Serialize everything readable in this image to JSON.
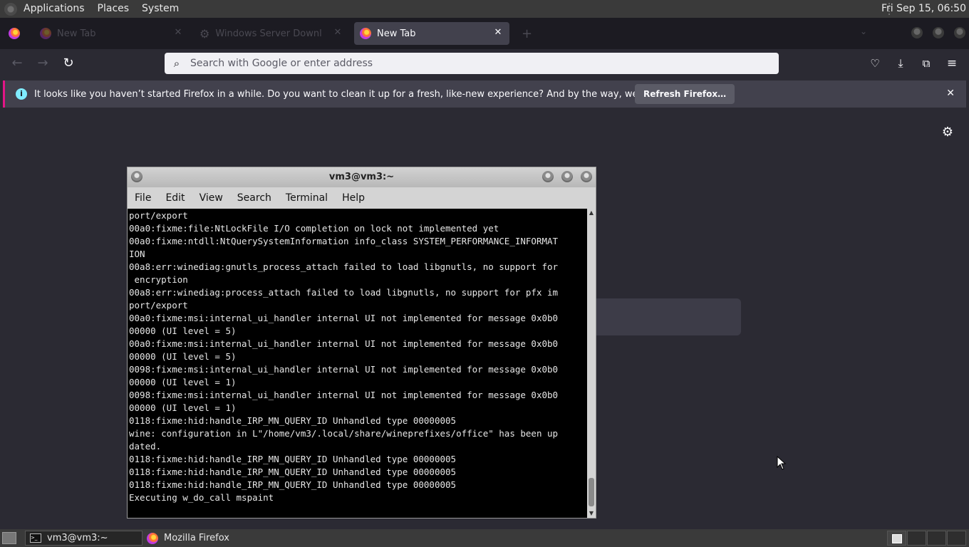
{
  "top_panel": {
    "menus": [
      "Applications",
      "Places",
      "System"
    ],
    "clock": "Fri Sep 15, 06:50"
  },
  "browser": {
    "tabs": [
      {
        "label": "New Tab",
        "active": false
      },
      {
        "label": "Windows Server Downlo",
        "active": false
      },
      {
        "label": "New Tab",
        "active": true
      }
    ],
    "new_tab_symbol": "+",
    "close_symbol": "✕",
    "url_placeholder": "Search with Google or enter address"
  },
  "notification": {
    "message": "It looks like you haven’t started Firefox in a while. Do you want to clean it up for a fresh, like-new experience? And by the way, welcome back!",
    "button": "Refresh Firefox…"
  },
  "terminal": {
    "title": "vm3@vm3:~",
    "menu": [
      "File",
      "Edit",
      "View",
      "Search",
      "Terminal",
      "Help"
    ],
    "lines": [
      "port/export",
      "00a0:fixme:file:NtLockFile I/O completion on lock not implemented yet",
      "00a0:fixme:ntdll:NtQuerySystemInformation info_class SYSTEM_PERFORMANCE_INFORMAT",
      "ION",
      "00a8:err:winediag:gnutls_process_attach failed to load libgnutls, no support for",
      " encryption",
      "00a8:err:winediag:process_attach failed to load libgnutls, no support for pfx im",
      "port/export",
      "00a0:fixme:msi:internal_ui_handler internal UI not implemented for message 0x0b0",
      "00000 (UI level = 5)",
      "00a0:fixme:msi:internal_ui_handler internal UI not implemented for message 0x0b0",
      "00000 (UI level = 5)",
      "0098:fixme:msi:internal_ui_handler internal UI not implemented for message 0x0b0",
      "00000 (UI level = 1)",
      "0098:fixme:msi:internal_ui_handler internal UI not implemented for message 0x0b0",
      "00000 (UI level = 1)",
      "0118:fixme:hid:handle_IRP_MN_QUERY_ID Unhandled type 00000005",
      "wine: configuration in L\"/home/vm3/.local/share/wineprefixes/office\" has been up",
      "dated.",
      "0118:fixme:hid:handle_IRP_MN_QUERY_ID Unhandled type 00000005",
      "0118:fixme:hid:handle_IRP_MN_QUERY_ID Unhandled type 00000005",
      "0118:fixme:hid:handle_IRP_MN_QUERY_ID Unhandled type 00000005",
      "Executing w_do_call mspaint"
    ]
  },
  "taskbar": {
    "items": [
      {
        "label": "vm3@vm3:~",
        "active": true
      },
      {
        "label": "Mozilla Firefox",
        "active": false
      }
    ]
  }
}
